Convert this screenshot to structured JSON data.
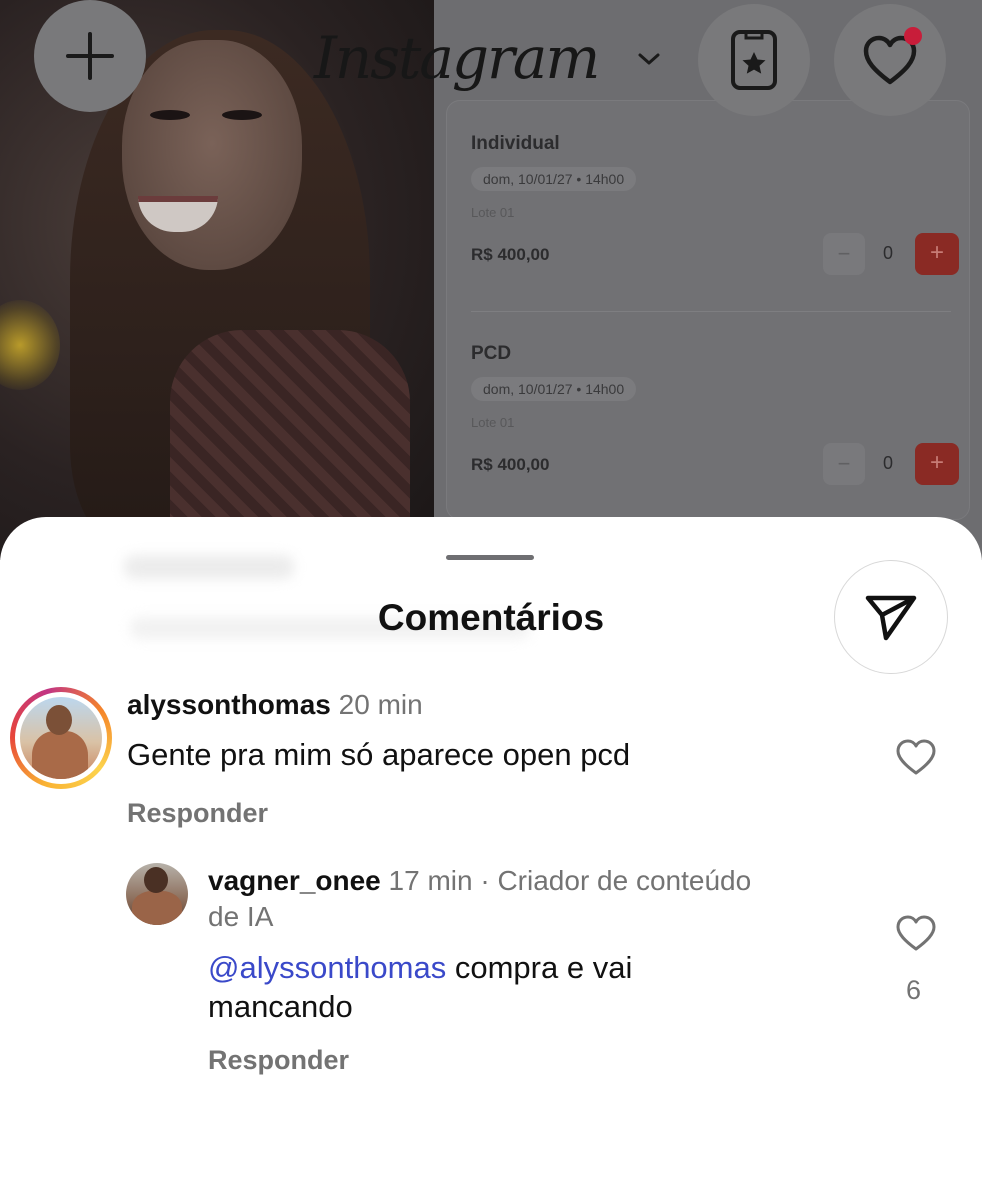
{
  "background": {
    "photo_description_icon": "woman-smiling-photo",
    "tickets": [
      {
        "name": "Individual",
        "date": "dom, 10/01/27 • 14h00",
        "lote": "Lote 01",
        "price": "R$ 400,00",
        "quantity": "0",
        "minus": "−",
        "plus": "+"
      },
      {
        "name": "PCD",
        "date": "dom, 10/01/27 • 14h00",
        "lote": "Lote 01",
        "price": "R$ 400,00",
        "quantity": "0",
        "minus": "−",
        "plus": "+"
      }
    ]
  },
  "top_bar": {
    "logo": "Instagram",
    "add_icon": "plus-icon",
    "chevron_icon": "chevron-down-icon",
    "collections_icon": "star-card-icon",
    "notifications_icon": "heart-icon",
    "notification_dot_color": "#c81d3a"
  },
  "sheet": {
    "title": "Comentários",
    "share_icon": "send-icon"
  },
  "comments": [
    {
      "username": "alyssonthomas",
      "time": "20 min",
      "text": "Gente pra mim só aparece open pcd",
      "reply_label": "Responder",
      "has_story_ring": true
    },
    {
      "username": "vagner_onee",
      "time": "17 min",
      "meta": "· Criador de conteúdo",
      "meta_cont": "de IA",
      "mention": "@alyssonthomas",
      "text_line1": " compra e vai",
      "text_line2": "mancando",
      "reply_label": "Responder",
      "like_count": "6"
    }
  ],
  "colors": {
    "mention": "#3a49c9",
    "meta_gray": "#737373",
    "dim_overlay": "#6a6a6c"
  }
}
